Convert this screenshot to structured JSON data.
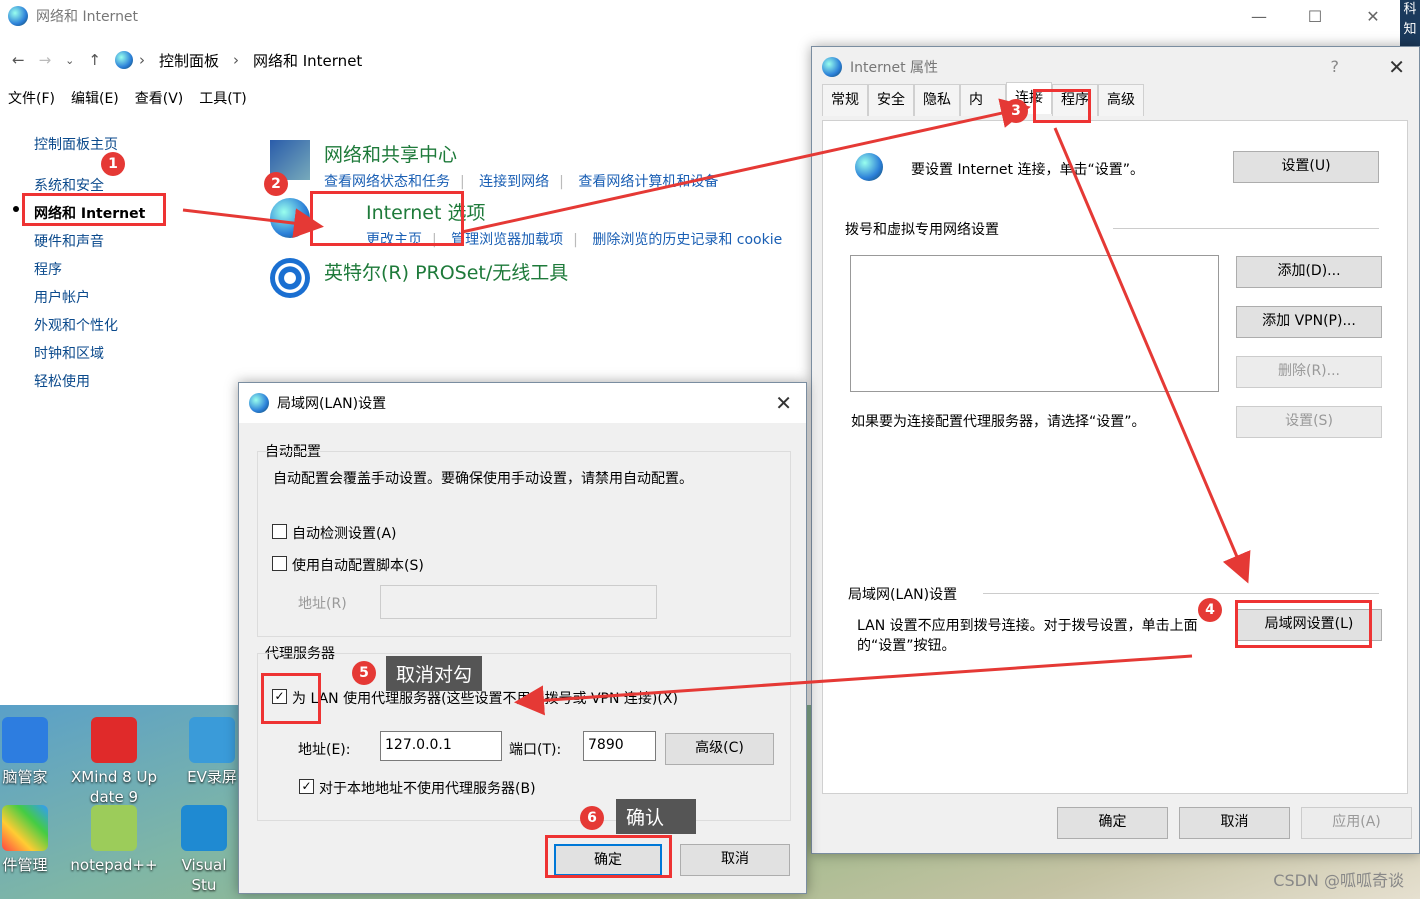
{
  "control_panel": {
    "window_title": "网络和 Internet",
    "breadcrumb": [
      "控制面板",
      "网络和 Internet"
    ],
    "menu": [
      "文件(F)",
      "编辑(E)",
      "查看(V)",
      "工具(T)"
    ],
    "left_nav": [
      "控制面板主页",
      "系统和安全",
      "网络和 Internet",
      "硬件和声音",
      "程序",
      "用户帐户",
      "外观和个性化",
      "时钟和区域",
      "轻松使用"
    ],
    "categories": [
      {
        "title": "网络和共享中心",
        "links": [
          "查看网络状态和任务",
          "连接到网络",
          "查看网络计算机和设备"
        ]
      },
      {
        "title": "Internet 选项",
        "links": [
          "更改主页",
          "管理浏览器加载项",
          "删除浏览的历史记录和 cookie"
        ]
      },
      {
        "title": "英特尔(R) PROSet/无线工具",
        "links": []
      }
    ]
  },
  "internet_props": {
    "title": "Internet 属性",
    "help": "?",
    "tabs": [
      "常规",
      "安全",
      "隐私",
      "内",
      "连接",
      "程序",
      "高级"
    ],
    "setup_text": "要设置 Internet 连接，单击“设置”。",
    "setup_button": "设置(U)",
    "dial_header": "拨号和虚拟专用网络设置",
    "add_button": "添加(D)...",
    "add_vpn_button": "添加 VPN(P)...",
    "remove_button": "删除(R)...",
    "settings_button": "设置(S)",
    "proxy_hint": "如果要为连接配置代理服务器，请选择“设置”。",
    "lan_header": "局域网(LAN)设置",
    "lan_text": "LAN 设置不应用到拨号连接。对于拨号设置，单击上面的“设置”按钮。",
    "lan_button": "局域网设置(L)",
    "ok": "确定",
    "cancel": "取消",
    "apply": "应用(A)"
  },
  "lan_dialog": {
    "title": "局域网(LAN)设置",
    "auto_group": "自动配置",
    "auto_desc": "自动配置会覆盖手动设置。要确保使用手动设置，请禁用自动配置。",
    "auto_detect": "自动检测设置(A)",
    "auto_script": "使用自动配置脚本(S)",
    "address_label": "地址(R)",
    "proxy_group": "代理服务器",
    "use_proxy": "为 LAN 使用代理服务器(这些设置不用于拨号或 VPN 连接)(X)",
    "addr_label": "地址(E):",
    "addr_value": "127.0.0.1",
    "port_label": "端口(T):",
    "port_value": "7890",
    "advanced": "高级(C)",
    "bypass_local": "对于本地地址不使用代理服务器(B)",
    "ok": "确定",
    "cancel": "取消"
  },
  "annotations": {
    "n1": "1",
    "n2": "2",
    "n3": "3",
    "n4": "4",
    "n5": "5",
    "n6": "6",
    "tip5": "取消对勾",
    "tip6": "确认"
  },
  "desktop": {
    "icons": [
      "脑管家",
      "XMind 8 Up date 9",
      "EV录屏",
      "件管理",
      "notepad++",
      "Visual Stu"
    ]
  },
  "corner": [
    "科",
    "知"
  ],
  "watermark": "CSDN @呱呱奇谈",
  "colors": {
    "annotation_red": "#e53935",
    "link_blue": "#1a5fb4",
    "category_green": "#1e7a3a"
  }
}
